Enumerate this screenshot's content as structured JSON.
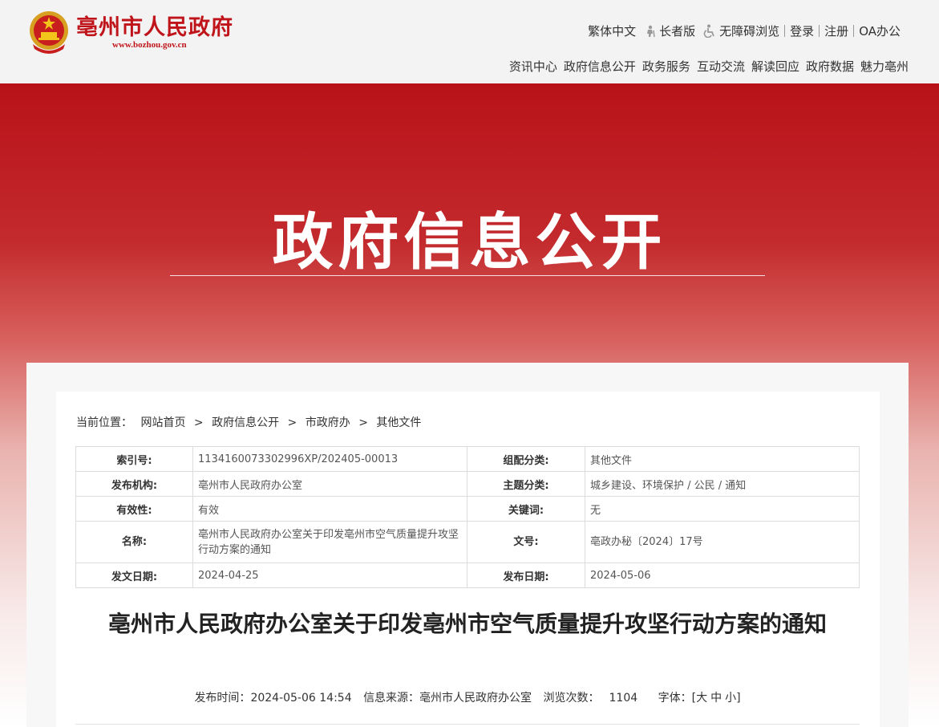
{
  "header": {
    "site_name": "亳州市人民政府",
    "site_url": "www.bozhou.gov.cn",
    "top_links": {
      "traditional": "繁体中文",
      "elder": "长者版",
      "accessible": "无障碍浏览",
      "login": "登录",
      "register": "注册",
      "oa": "OA办公"
    },
    "nav": [
      "资讯中心",
      "政府信息公开",
      "政务服务",
      "互动交流",
      "解读回应",
      "政府数据",
      "魅力亳州"
    ]
  },
  "banner": {
    "title": "政府信息公开"
  },
  "breadcrumb": {
    "label": "当前位置：",
    "items": [
      "网站首页",
      "政府信息公开",
      "市政府办",
      "其他文件"
    ],
    "separator": ">"
  },
  "meta": {
    "index_no_label": "索引号:",
    "index_no": "1134160073302996XP/202405-00013",
    "category_label": "组配分类:",
    "category": "其他文件",
    "publisher_label": "发布机构:",
    "publisher": "亳州市人民政府办公室",
    "topic_label": "主题分类:",
    "topic": "城乡建设、环境保护 / 公民 / 通知",
    "validity_label": "有效性:",
    "validity": "有效",
    "keywords_label": "关键词:",
    "keywords": "无",
    "name_label": "名称:",
    "name": "亳州市人民政府办公室关于印发亳州市空气质量提升攻坚行动方案的通知",
    "doc_no_label": "文号:",
    "doc_no": "亳政办秘〔2024〕17号",
    "issue_date_label": "发文日期:",
    "issue_date": "2024-04-25",
    "publish_date_label": "发布日期:",
    "publish_date": "2024-05-06"
  },
  "document": {
    "title": "亳州市人民政府办公室关于印发亳州市空气质量提升攻坚行动方案的通知",
    "publish_time_label": "发布时间：",
    "publish_time": "2024-05-06 14:54",
    "source_label": "信息来源：",
    "source": "亳州市人民政府办公室",
    "views_label": "浏览次数：",
    "views": "1104",
    "font_label": "字体：",
    "font_open": "[",
    "font_large": "大",
    "font_medium": "中",
    "font_small": "小",
    "font_close": "]"
  },
  "colors": {
    "brand_red": "#c0141b",
    "banner_red": "#b81218"
  }
}
